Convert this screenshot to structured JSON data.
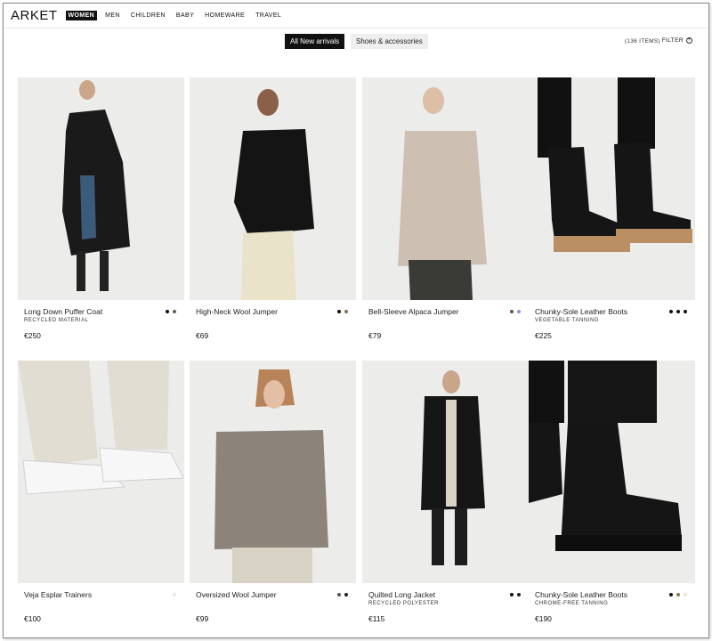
{
  "header": {
    "logo": "ARKET",
    "nav": [
      "WOMEN",
      "MEN",
      "CHILDREN",
      "BABY",
      "HOMEWARE",
      "TRAVEL"
    ],
    "active_nav": "WOMEN"
  },
  "filters": {
    "active_chip": "All New arrivals",
    "chip_2": "Shoes & accessories",
    "items_count": "(136 ITEMS)",
    "filter_label": "FILTER"
  },
  "products": [
    {
      "name": "Long Down Puffer Coat",
      "tag": "RECYCLED MATERIAL",
      "price": "€250",
      "swatches": [
        "#111111",
        "#6b5a4a"
      ],
      "image_icon": "puffer-coat-image"
    },
    {
      "name": "High-Neck Wool Jumper",
      "tag": "",
      "price": "€69",
      "swatches": [
        "#111111",
        "#8a6d4c"
      ],
      "image_icon": "wool-jumper-image"
    },
    {
      "name": "Bell-Sleeve Alpaca Jumper",
      "tag": "",
      "price": "€79",
      "swatches": [
        "#6b4f3b",
        "#8f8fd8"
      ],
      "image_icon": "alpaca-jumper-image"
    },
    {
      "name": "Chunky-Sole Leather Boots",
      "tag": "VEGETABLE TANNING",
      "price": "€225",
      "swatches": [
        "#111111",
        "#111111",
        "#111111"
      ],
      "image_icon": "leather-boots-image"
    },
    {
      "name": "Veja Esplar Trainers",
      "tag": "",
      "price": "€100",
      "swatches": [
        "#e6e6e6"
      ],
      "image_icon": "trainers-image"
    },
    {
      "name": "Oversized Wool Jumper",
      "tag": "",
      "price": "€99",
      "swatches": [
        "#555555",
        "#222222"
      ],
      "image_icon": "oversized-jumper-image"
    },
    {
      "name": "Quilted Long Jacket",
      "tag": "RECYCLED POLYESTER",
      "price": "€115",
      "swatches": [
        "#111111",
        "#222222"
      ],
      "image_icon": "quilted-jacket-image"
    },
    {
      "name": "Chunky-Sole Leather Boots",
      "tag": "CHROME-FREE TANNING",
      "price": "€190",
      "swatches": [
        "#111111",
        "#8a7a50",
        "#ece6cf"
      ],
      "image_icon": "chelsea-boots-image"
    }
  ]
}
